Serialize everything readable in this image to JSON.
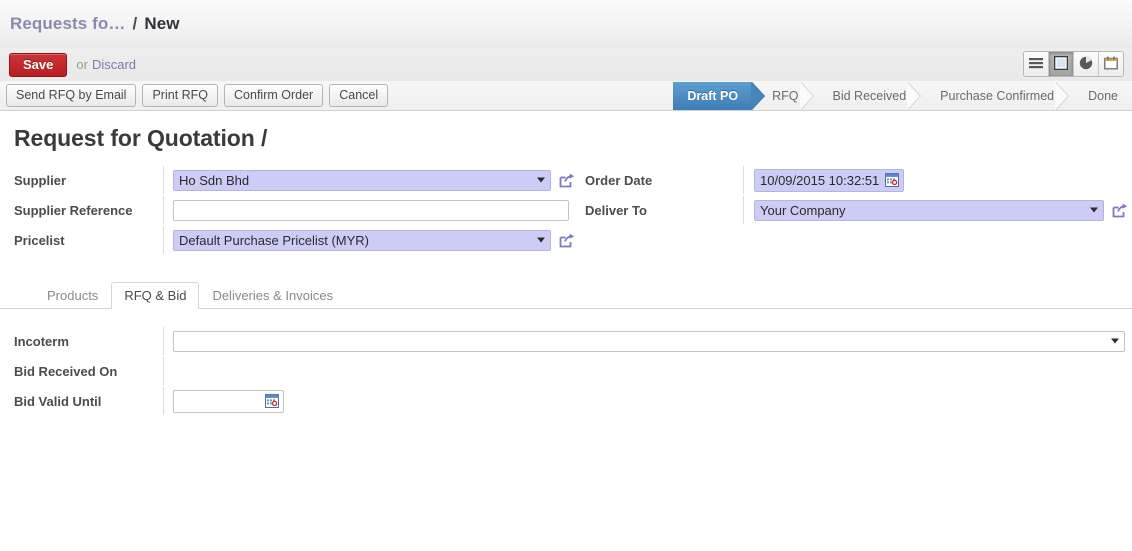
{
  "breadcrumb": {
    "parent": "Requests fo…",
    "separator": "/",
    "current": "New"
  },
  "toolbar": {
    "save_label": "Save",
    "or_label": "or",
    "discard_label": "Discard"
  },
  "view_switcher": [
    {
      "name": "list-view",
      "icon": "list-icon",
      "active": false
    },
    {
      "name": "form-view",
      "icon": "form-icon",
      "active": true
    },
    {
      "name": "graph-view",
      "icon": "pie-chart-icon",
      "active": false
    },
    {
      "name": "calendar-view",
      "icon": "calendar-icon",
      "active": false
    }
  ],
  "action_buttons": [
    "Send RFQ by Email",
    "Print RFQ",
    "Confirm Order",
    "Cancel"
  ],
  "status_steps": [
    {
      "label": "Draft PO",
      "active": true
    },
    {
      "label": "RFQ",
      "active": false
    },
    {
      "label": "Bid Received",
      "active": false
    },
    {
      "label": "Purchase Confirmed",
      "active": false
    },
    {
      "label": "Done",
      "active": false
    }
  ],
  "form": {
    "title": "Request for Quotation",
    "title_suffix": "/",
    "left": {
      "supplier_label": "Supplier",
      "supplier_value": "Ho Sdn Bhd",
      "supplier_reference_label": "Supplier Reference",
      "supplier_reference_value": "",
      "pricelist_label": "Pricelist",
      "pricelist_value": "Default Purchase Pricelist (MYR)"
    },
    "right": {
      "order_date_label": "Order Date",
      "order_date_value": "10/09/2015 10:32:51",
      "deliver_to_label": "Deliver To",
      "deliver_to_value": "Your Company"
    }
  },
  "tabs": [
    {
      "label": "Products",
      "active": false
    },
    {
      "label": "RFQ & Bid",
      "active": true
    },
    {
      "label": "Deliveries & Invoices",
      "active": false
    }
  ],
  "rfq_bid": {
    "incoterm_label": "Incoterm",
    "incoterm_value": "",
    "bid_received_on_label": "Bid Received On",
    "bid_received_on_value": "",
    "bid_valid_until_label": "Bid Valid Until",
    "bid_valid_until_value": ""
  },
  "colors": {
    "save_red": "#b81f22",
    "active_step_blue": "#3f7cb4",
    "field_lavender": "#ccccf6",
    "breadcrumb_purple": "#8a8ab0"
  }
}
